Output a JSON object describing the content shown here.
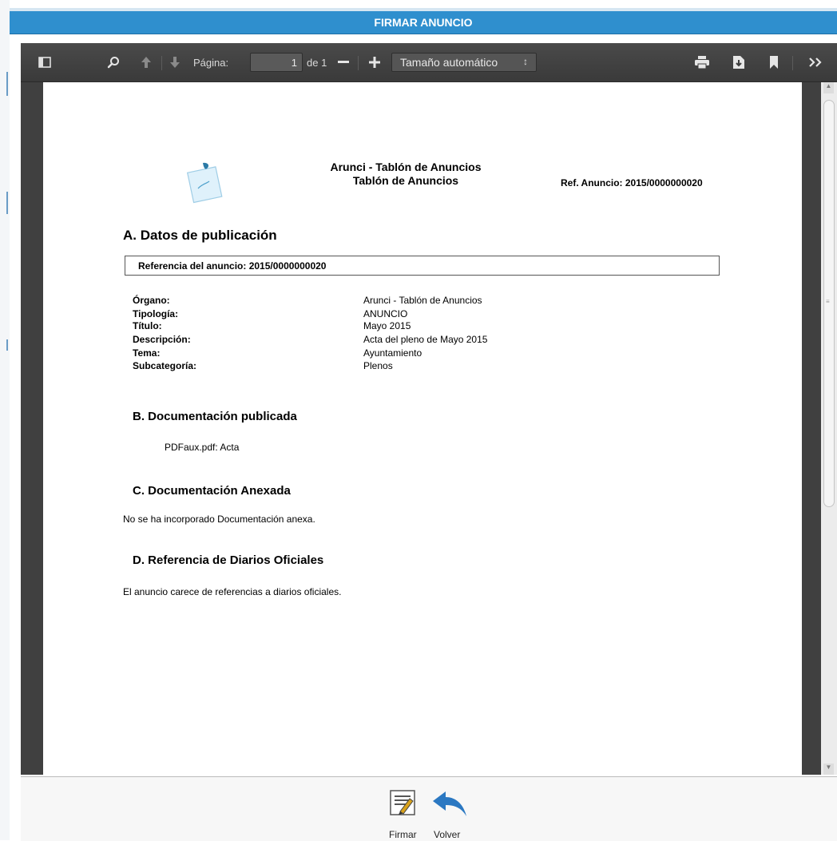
{
  "dialog": {
    "title": "FIRMAR ANUNCIO"
  },
  "toolbar": {
    "page_label": "Página:",
    "page_value": "1",
    "page_total": "de 1",
    "zoom_value": "Tamaño automático",
    "icons": [
      "sidebar-toggle-icon",
      "search-icon",
      "arrow-up-icon",
      "arrow-down-icon",
      "zoom-out-icon",
      "zoom-in-icon",
      "print-icon",
      "download-icon",
      "bookmark-icon",
      "more-tools-icon"
    ]
  },
  "document": {
    "header_line1": "Arunci - Tablón de Anuncios",
    "header_line2": "Tablón de Anuncios",
    "ref_header": "Ref. Anuncio: 2015/0000000020",
    "section_a_title": "A. Datos de publicación",
    "ref_box": "Referencia del anuncio: 2015/0000000020",
    "fields": [
      {
        "label": "Órgano:",
        "value": "Arunci - Tablón de Anuncios"
      },
      {
        "label": "Tipología:",
        "value": "ANUNCIO"
      },
      {
        "label": "Título:",
        "value": "Mayo 2015"
      },
      {
        "label": "Descripción:",
        "value": "Acta del pleno de Mayo 2015"
      },
      {
        "label": "Tema:",
        "value": "Ayuntamiento"
      },
      {
        "label": "Subcategoría:",
        "value": "Plenos"
      }
    ],
    "section_b_title": "B. Documentación publicada",
    "section_b_item": "PDFaux.pdf: Acta",
    "section_c_title": "C. Documentación Anexada",
    "section_c_text": "No se ha incorporado Documentación anexa.",
    "section_d_title": "D. Referencia de Diarios Oficiales",
    "section_d_text": "El anuncio carece de referencias a diarios oficiales."
  },
  "actions": {
    "sign_label": "Firmar",
    "back_label": "Volver"
  },
  "colors": {
    "titlebar": "#2f8fce",
    "toolbar": "#404040",
    "back_arrow": "#2b78c2"
  }
}
